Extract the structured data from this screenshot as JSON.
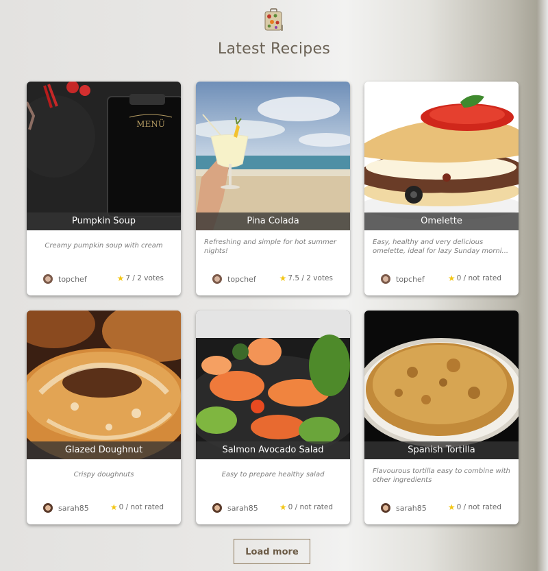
{
  "page": {
    "title": "Latest Recipes"
  },
  "load_more_label": "Load more",
  "recipes": [
    {
      "name": "Pumpkin Soup",
      "description": "Creamy pumpkin soup with cream",
      "author": "topchef",
      "rating": "7 / 2 votes",
      "image": "menu-board-photo"
    },
    {
      "name": "Pina Colada",
      "description": "Refreshing and simple for hot summer nights!",
      "author": "topchef",
      "rating": "7.5 / 2 votes",
      "image": "beach-cocktail-photo"
    },
    {
      "name": "Omelette",
      "description": "Easy, healthy and very delicious omelette, ideal for lazy Sunday morni...",
      "author": "topchef",
      "rating": "0 / not rated",
      "image": "omelette-photo"
    },
    {
      "name": "Glazed Doughnut",
      "description": "Crispy doughnuts",
      "author": "sarah85",
      "rating": "0 / not rated",
      "image": "doughnut-photo"
    },
    {
      "name": "Salmon Avocado Salad",
      "description": "Easy to prepare healthy salad",
      "author": "sarah85",
      "rating": "0 / not rated",
      "image": "salmon-salad-photo"
    },
    {
      "name": "Spanish Tortilla",
      "description": "Flavourous tortilla easy to combine with other ingredients",
      "author": "sarah85",
      "rating": "0 / not rated",
      "image": "tortilla-photo"
    }
  ],
  "colors": {
    "accent": "#6b6255",
    "star": "#f3c614",
    "caption_bg": "#343434"
  }
}
